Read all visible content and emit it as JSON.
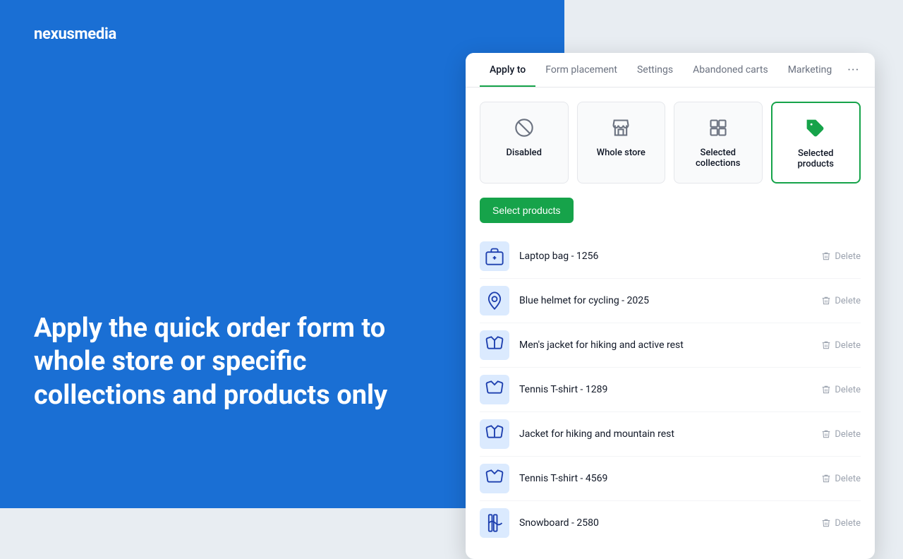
{
  "logo": {
    "prefix": "nexus",
    "suffix": "media"
  },
  "hero": {
    "text": "Apply the quick order form to whole store or specific collections and products only"
  },
  "tabs": [
    {
      "id": "apply-to",
      "label": "Apply to",
      "active": true
    },
    {
      "id": "form-placement",
      "label": "Form placement",
      "active": false
    },
    {
      "id": "settings",
      "label": "Settings",
      "active": false
    },
    {
      "id": "abandoned-carts",
      "label": "Abandoned carts",
      "active": false
    },
    {
      "id": "marketing",
      "label": "Marketing",
      "active": false
    }
  ],
  "more_label": "···",
  "options": [
    {
      "id": "disabled",
      "label": "Disabled",
      "selected": false,
      "icon": "ban"
    },
    {
      "id": "whole-store",
      "label": "Whole store",
      "selected": false,
      "icon": "store"
    },
    {
      "id": "selected-collections",
      "label": "Selected collections",
      "selected": false,
      "icon": "collection"
    },
    {
      "id": "selected-products",
      "label": "Selected products",
      "selected": true,
      "icon": "tag"
    }
  ],
  "select_products_button": "Select products",
  "products": [
    {
      "id": 1,
      "name": "Laptop bag - 1256",
      "emoji": "🎒",
      "color": "#dbeafe"
    },
    {
      "id": 2,
      "name": "Blue helmet for cycling - 2025",
      "emoji": "🪖",
      "color": "#dbeafe"
    },
    {
      "id": 3,
      "name": "Men's jacket for hiking and active rest",
      "emoji": "🧥",
      "color": "#dbeafe"
    },
    {
      "id": 4,
      "name": "Tennis T-shirt - 1289",
      "emoji": "👕",
      "color": "#dbeafe"
    },
    {
      "id": 5,
      "name": "Jacket for hiking and mountain rest",
      "emoji": "🧥",
      "color": "#dbeafe"
    },
    {
      "id": 6,
      "name": "Tennis T-shirt - 4569",
      "emoji": "👕",
      "color": "#dbeafe"
    },
    {
      "id": 7,
      "name": "Snowboard - 2580",
      "emoji": "🏂",
      "color": "#dbeafe"
    }
  ],
  "delete_label": "Delete",
  "colors": {
    "accent": "#16a34a",
    "blue_bg": "#1a6fd4"
  }
}
